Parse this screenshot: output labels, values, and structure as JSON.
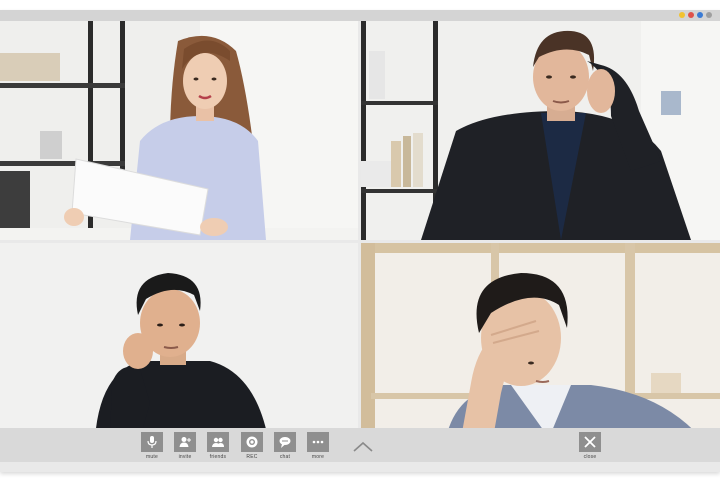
{
  "window": {
    "dots": [
      {
        "name": "window-dot-yellow",
        "color": "#f2c230"
      },
      {
        "name": "window-dot-red",
        "color": "#e0524a"
      },
      {
        "name": "window-dot-blue",
        "color": "#3a7bd5"
      },
      {
        "name": "window-dot-gray",
        "color": "#9e9e9e"
      }
    ]
  },
  "participants": [
    {
      "id": "tile-woman-with-paper"
    },
    {
      "id": "tile-man-in-suit"
    },
    {
      "id": "tile-man-resting-cheek"
    },
    {
      "id": "tile-man-hand-on-forehead"
    }
  ],
  "toolbar": {
    "buttons": [
      {
        "name": "mute-button",
        "icon": "microphone-icon",
        "label": "mute"
      },
      {
        "name": "invite-button",
        "icon": "add-user-icon",
        "label": "invite"
      },
      {
        "name": "friends-button",
        "icon": "users-icon",
        "label": "friends"
      },
      {
        "name": "record-button",
        "icon": "record-icon",
        "label": "REC"
      },
      {
        "name": "chat-button",
        "icon": "chat-bubble-icon",
        "label": "chat"
      },
      {
        "name": "more-button",
        "icon": "ellipsis-icon",
        "label": "more"
      }
    ],
    "expand_icon": "chevron-up-icon",
    "close": {
      "icon": "close-icon",
      "label": "close"
    }
  }
}
